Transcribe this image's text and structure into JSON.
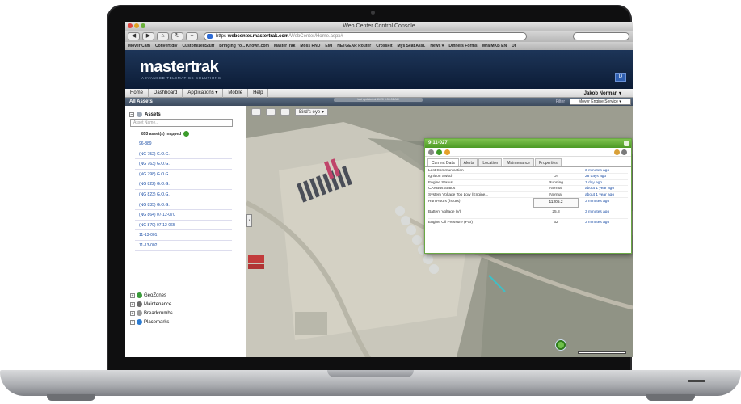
{
  "window": {
    "title": "Web Center Control Console"
  },
  "browser": {
    "url_prefix": "https",
    "url_domain": "webcenter.mastertrak.com",
    "url_path": "/WebCenter/Home.aspx#",
    "bookmarks": [
      "Mover Cam",
      "Convert div",
      "CustomizedStuff",
      "Bringing Yo... Known.com",
      "MasterTrak",
      "Moss RND",
      "EMI",
      "NETGEAR Router",
      "CrossFit",
      "Mys Seat Assi.",
      "News ▾",
      "Dinners Forms",
      "Wra MKB EN",
      "Dr"
    ]
  },
  "app": {
    "logo": "mastertrak",
    "tagline": "ADVANCED TELEMATICS SOLUTIONS",
    "menu": [
      "Home",
      "Dashboard",
      "Applications ▾",
      "Mobile",
      "Help"
    ],
    "user": "Jakob Norman ▾",
    "assets_bar_title": "All Assets",
    "filter_label": "Filter",
    "service_select": "Mover Engine Service ▾",
    "progress_label": "last updated at 11/20 9:30:02 AM"
  },
  "sidebar": {
    "tree_title": "Assets",
    "filter_placeholder": "Asset Name...",
    "mapped_text": "853 asset(s) mapped",
    "assets": [
      "96-889",
      "(NG 752) G.O.G.",
      "(NG 763) G.O.G.",
      "(NG 798) G.O.G.",
      "(NG 822) G.O.G.",
      "(NG 823) G.O.G.",
      "(NG 835) G.O.G.",
      "(NG 864) 07-12-070",
      "(NG 870) 07-12-065",
      "11-13-001",
      "11-13-002"
    ],
    "groups": [
      "GeoZones",
      "Maintenance",
      "Breadcrumbs",
      "Placemarks"
    ]
  },
  "map": {
    "view_label": "Bird's eye ▾"
  },
  "popup": {
    "title": "9-11-027",
    "tabs": [
      "Current Data",
      "Alerts",
      "Location",
      "Maintenance",
      "Properties"
    ],
    "rows": [
      {
        "label": "Last Communication",
        "value": "",
        "time": "3 minutes ago"
      },
      {
        "label": "Ignition Switch",
        "value": "On",
        "time": "28 days ago"
      },
      {
        "label": "Engine Status",
        "value": "Running",
        "time": "1 day ago"
      },
      {
        "label": "CANBus Status",
        "value": "Normal",
        "time": "about 1 year ago"
      },
      {
        "label": "System Voltage Too Low (Engine...",
        "value": "Normal",
        "time": "about 1 year ago"
      },
      {
        "label": "Run Hours (hours)",
        "value": "11205.2",
        "time": "3 minutes ago"
      },
      {
        "label": "Battery Voltage (V)",
        "value": "25.8",
        "time": "3 minutes ago"
      },
      {
        "label": "Engine Oil Pressure (PSI)",
        "value": "62",
        "time": "3 minutes ago"
      }
    ]
  },
  "colors": {
    "banner": "#142a4b",
    "popup_header": "#5aa830",
    "link": "#1d4fa6"
  }
}
